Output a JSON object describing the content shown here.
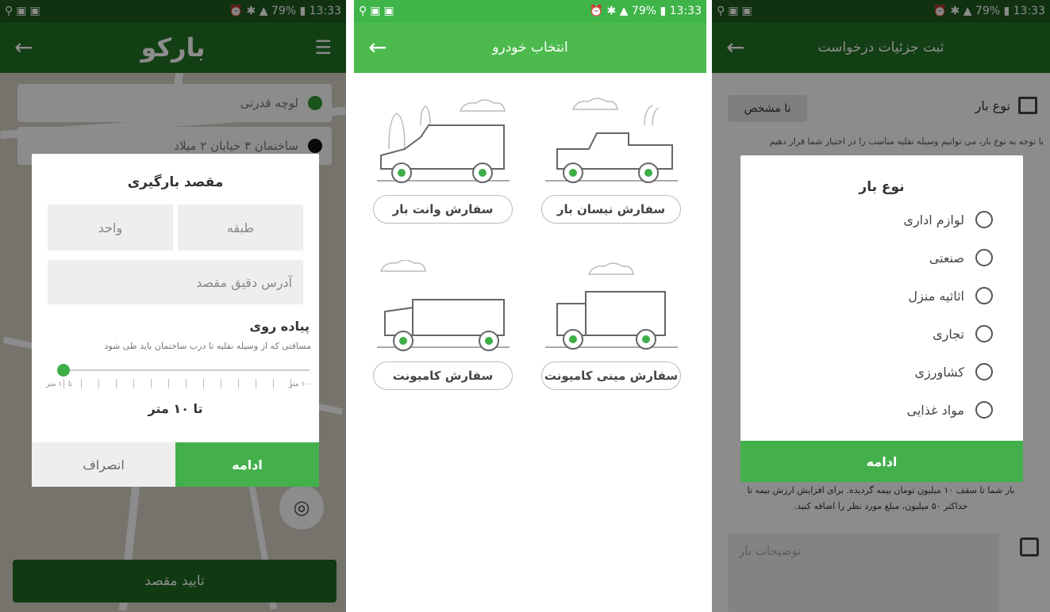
{
  "status_bar": {
    "battery": "79%",
    "time": "13:33"
  },
  "panel1": {
    "logo_text": "بارکو",
    "origin": "لوچه قدرتی",
    "destination": "ساختمان ۳ خیابان ۲ میلاد",
    "dialog": {
      "title": "مقصد بارگیری",
      "floor_placeholder": "طبقه",
      "unit_placeholder": "واحد",
      "address_placeholder": "آدرس دقیق مقصد",
      "walk_title": "پیاده روی",
      "walk_desc": "مسافتی که از وسیله نقلیه تا درب ساختمان باید طی شود",
      "tick_min": "تا ۱۰ متر",
      "tick_max": "۱۰۰ متر",
      "distance_value": "تا ۱۰ متر",
      "continue_label": "ادامه",
      "cancel_label": "انصراف"
    },
    "confirm_label": "تایید مقصد",
    "locate_icon": "target-icon"
  },
  "panel2": {
    "title": "انتخاب خودرو",
    "vehicles": [
      {
        "label": "سفارش نیسان بار",
        "icon": "pickup-truck-icon"
      },
      {
        "label": "سفارش وانت بار",
        "icon": "van-icon"
      },
      {
        "label": "سفارش مینی کامیونت",
        "icon": "mini-truck-icon"
      },
      {
        "label": "سفارش کامیونت",
        "icon": "truck-icon"
      }
    ]
  },
  "panel3": {
    "title": "ثبت جزئیات درخواست",
    "cargo_type_label": "نوع بار",
    "unknown_label": "نا مشخص",
    "hint": "با توجه به نوع بار، می توانیم وسیله نقلیه مناسب را در اختیار شما قرار دهیم",
    "insurance_line1": "بار شما تا سقف ۱۰ میلیون تومان بیمه گردیده. برای افزایش ارزش بیمه تا",
    "insurance_line2": "حداکثر ۵۰ میلیون، مبلغ مورد نظر را اضافه کنید.",
    "notes_placeholder": "توضیحات بار",
    "dialog": {
      "title": "نوع بار",
      "options": [
        "لوازم اداری",
        "صنعتی",
        "اثاثیه منزل",
        "تجاری",
        "کشاورزی",
        "مواد غذایی"
      ],
      "continue_label": "ادامه"
    }
  },
  "colors": {
    "dark_green": "#237426",
    "green": "#4cba4d",
    "accent_green": "#43b04c"
  }
}
